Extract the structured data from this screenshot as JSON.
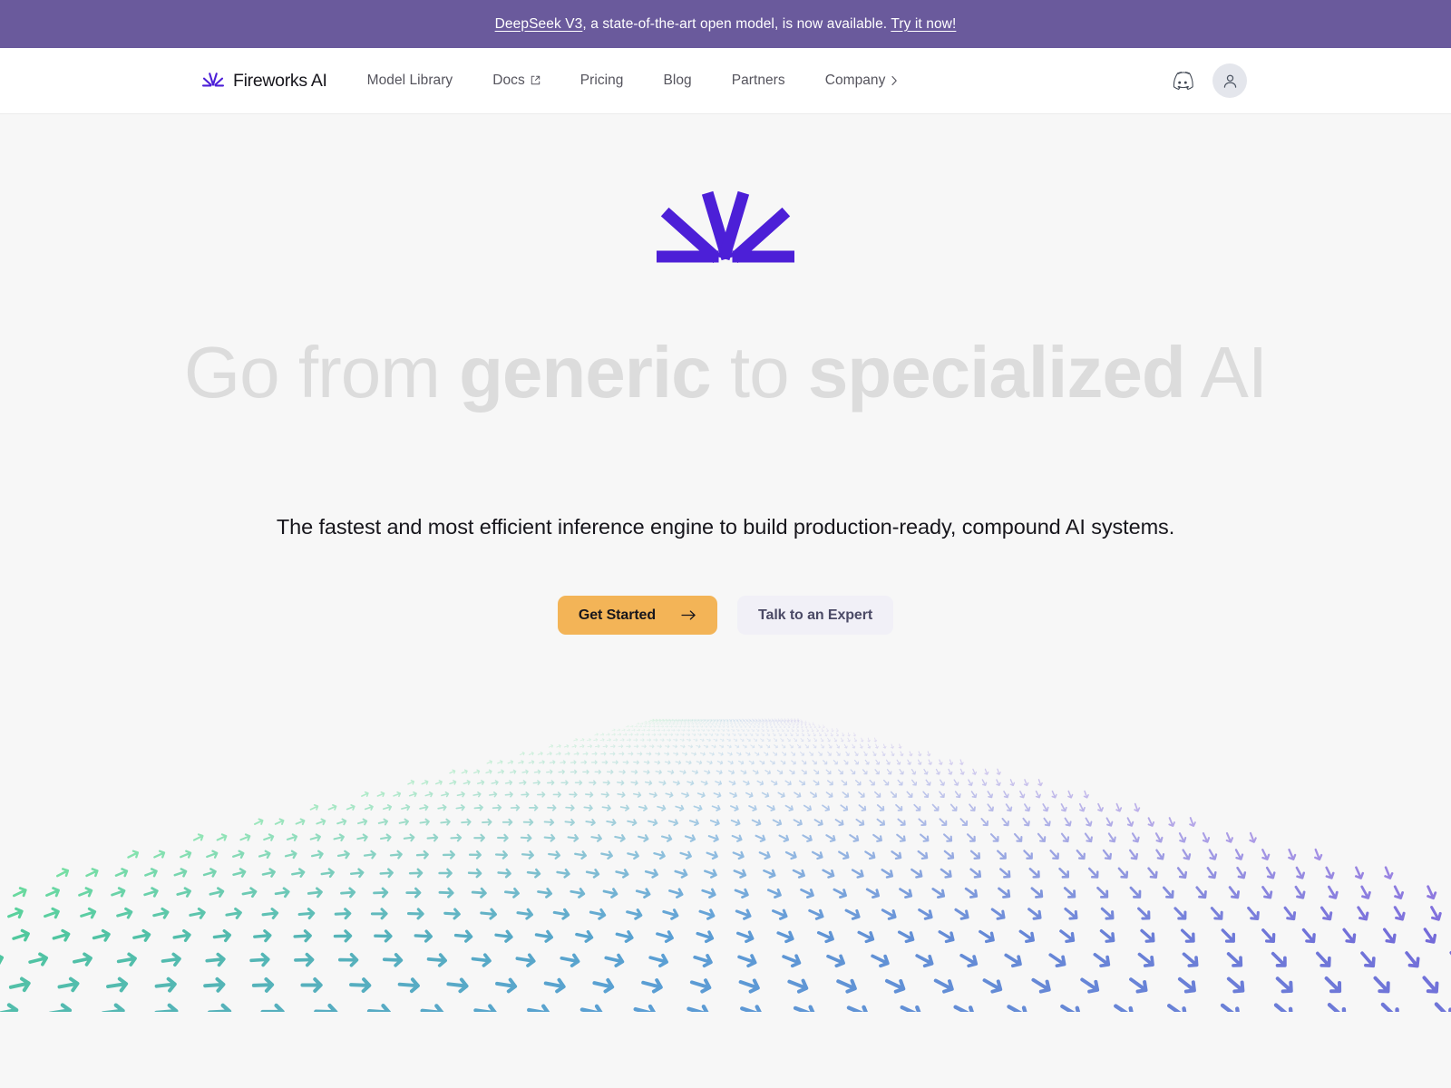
{
  "announcement": {
    "link_text": "DeepSeek V3",
    "middle_text": ", a state-of-the-art open model, is now available. ",
    "cta_text": "Try it now!",
    "background": "#6a5a9c"
  },
  "navbar": {
    "brand_name": "Fireworks AI",
    "brand_logo_icon": "fireworks-burst-icon",
    "links": [
      {
        "label": "Model Library",
        "icon": ""
      },
      {
        "label": "Docs",
        "icon": "external-link-icon"
      },
      {
        "label": "Pricing",
        "icon": ""
      },
      {
        "label": "Blog",
        "icon": ""
      },
      {
        "label": "Partners",
        "icon": ""
      },
      {
        "label": "Company",
        "icon": "chevron-right-icon"
      }
    ],
    "discord_icon": "discord-icon",
    "avatar_icon": "user-avatar-icon"
  },
  "hero": {
    "logo_icon": "fireworks-burst-large-icon",
    "logo_color": "#4c1fd7",
    "headline": {
      "part1": "Go from ",
      "part2": "generic",
      "part3": " to ",
      "part4": "specialized",
      "part5": " AI",
      "color": "#dcdcdc"
    },
    "subtitle": "The fastest and most efficient inference engine to build production-ready, compound AI systems.",
    "primary_cta": {
      "label": "Get Started",
      "icon": "arrow-right-icon",
      "background": "#f3b457"
    },
    "secondary_cta": {
      "label": "Talk to an Expert",
      "background": "#f1f0f7",
      "color": "#4b4a66"
    }
  },
  "vector_field": {
    "glyph": "arrow-glyph",
    "color_start": "#4ade80",
    "color_mid": "#5a9fd4",
    "color_end": "#7c5cdb",
    "rows": 26,
    "cols": 46
  },
  "theme": {
    "page_background": "#f7f7f7",
    "nav_background": "#ffffff",
    "brand_purple": "#4c1fd7",
    "accent_amber": "#f3b457"
  }
}
